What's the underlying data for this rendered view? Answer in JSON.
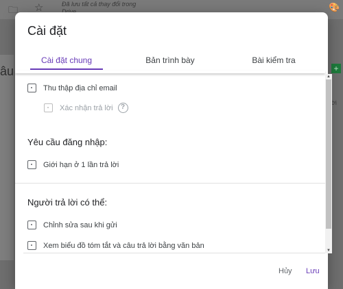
{
  "background": {
    "saved_text": "Đã lưu tất cả thay đổi trong Drive",
    "title_fragment": "âu",
    "right_fragment": "ời",
    "icons": [
      "folder-icon",
      "star-icon",
      "palette-icon",
      "add-icon"
    ]
  },
  "dialog": {
    "title": "Cài đặt",
    "tabs": [
      {
        "label": "Cài đặt chung",
        "active": true
      },
      {
        "label": "Bản trình bày",
        "active": false
      },
      {
        "label": "Bài kiểm tra",
        "active": false
      }
    ],
    "general": {
      "collect_email": "Thu thập địa chỉ email",
      "response_receipt": "Xác nhận trả lời",
      "signin_heading": "Yêu cầu đăng nhập:",
      "limit_one": "Giới hạn ở 1 lần trả lời",
      "respondents_heading": "Người trả lời có thể:",
      "edit_after": "Chỉnh sửa sau khi gửi",
      "see_summary": "Xem biểu đồ tóm tắt và câu trả lời bằng văn bản"
    },
    "buttons": {
      "cancel": "Hủy",
      "save": "Lưu"
    }
  },
  "colors": {
    "accent": "#673ab7",
    "scrim": "#6e6e6e"
  }
}
